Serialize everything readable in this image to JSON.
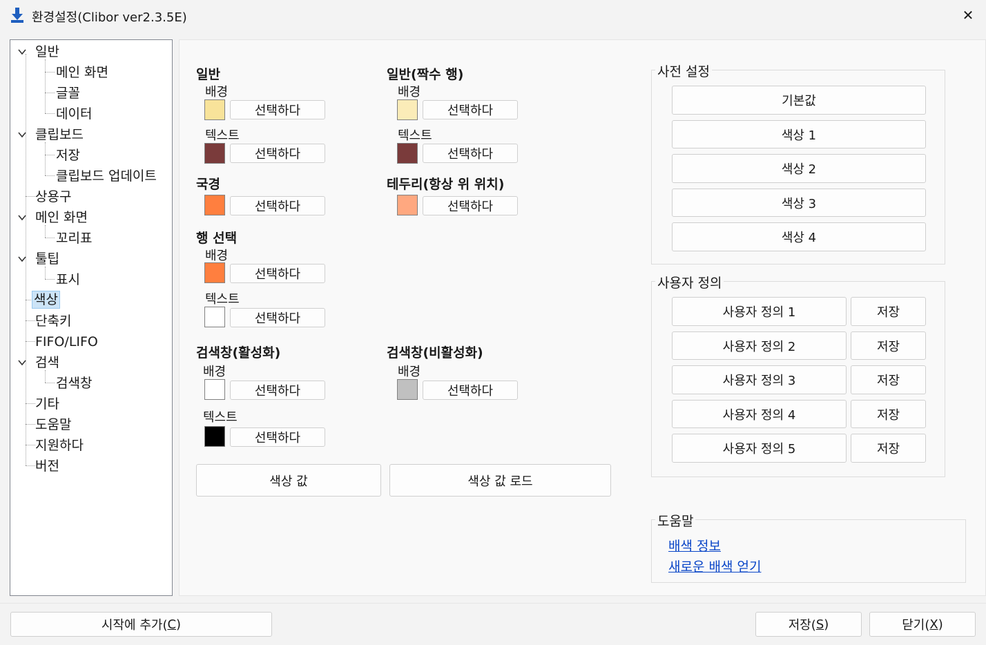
{
  "window": {
    "title": "환경설정(Clibor ver2.3.5E)",
    "close_glyph": "✕"
  },
  "tree": {
    "items": [
      {
        "label": "일반"
      },
      {
        "label": "메인 화면"
      },
      {
        "label": "글꼴"
      },
      {
        "label": "데이터"
      },
      {
        "label": "클립보드"
      },
      {
        "label": "저장"
      },
      {
        "label": "클립보드 업데이트"
      },
      {
        "label": "상용구"
      },
      {
        "label": "메인 화면"
      },
      {
        "label": "꼬리표"
      },
      {
        "label": "툴팁"
      },
      {
        "label": "표시"
      },
      {
        "label": "색상"
      },
      {
        "label": "단축키"
      },
      {
        "label": "FIFO/LIFO"
      },
      {
        "label": "검색"
      },
      {
        "label": "검색창"
      },
      {
        "label": "기타"
      },
      {
        "label": "도움말"
      },
      {
        "label": "지원하다"
      },
      {
        "label": "버전"
      }
    ],
    "selected": "색상"
  },
  "colors": {
    "select_label": "선택하다",
    "sections": {
      "general": {
        "title": "일반",
        "bg_label": "배경",
        "text_label": "텍스트",
        "bg_color": "#f8e39a",
        "text_color": "#7a3b3b"
      },
      "general_even": {
        "title": "일반(짝수 행)",
        "bg_label": "배경",
        "text_label": "텍스트",
        "bg_color": "#fbecb8",
        "text_color": "#7a3b3b"
      },
      "border": {
        "title": "국경",
        "color": "#ff7f3f"
      },
      "edge_on_top": {
        "title": "테두리(항상 위 위치)",
        "color": "#ffa880"
      },
      "row_select": {
        "title": "행 선택",
        "bg_label": "배경",
        "text_label": "텍스트",
        "bg_color": "#ff7f3f",
        "text_color": "#ffffff"
      },
      "search_active": {
        "title": "검색창(활성화)",
        "bg_label": "배경",
        "text_label": "텍스트",
        "bg_color": "#ffffff",
        "text_color": "#000000"
      },
      "search_inactive": {
        "title": "검색창(비활성화)",
        "bg_label": "배경",
        "bg_color": "#c0c0c0"
      }
    },
    "color_value_button": "색상 값",
    "load_color_value_button": "색상 값 로드"
  },
  "presets": {
    "title": "사전 설정",
    "buttons": [
      "기본값",
      "색상 1",
      "색상 2",
      "색상 3",
      "색상 4"
    ]
  },
  "custom": {
    "title": "사용자 정의",
    "rows": [
      {
        "label": "사용자 정의 1",
        "save": "저장"
      },
      {
        "label": "사용자 정의 2",
        "save": "저장"
      },
      {
        "label": "사용자 정의 3",
        "save": "저장"
      },
      {
        "label": "사용자 정의 4",
        "save": "저장"
      },
      {
        "label": "사용자 정의 5",
        "save": "저장"
      }
    ]
  },
  "help": {
    "title": "도움말",
    "links": [
      "배색 정보",
      "새로운 배색 얻기"
    ]
  },
  "footer": {
    "add_startup": {
      "text": "시작에 추가(",
      "key": "C",
      "end": ")"
    },
    "save": {
      "text": "저장(",
      "key": "S",
      "end": ")"
    },
    "close": {
      "text": "닫기(",
      "key": "X",
      "end": ")"
    }
  }
}
